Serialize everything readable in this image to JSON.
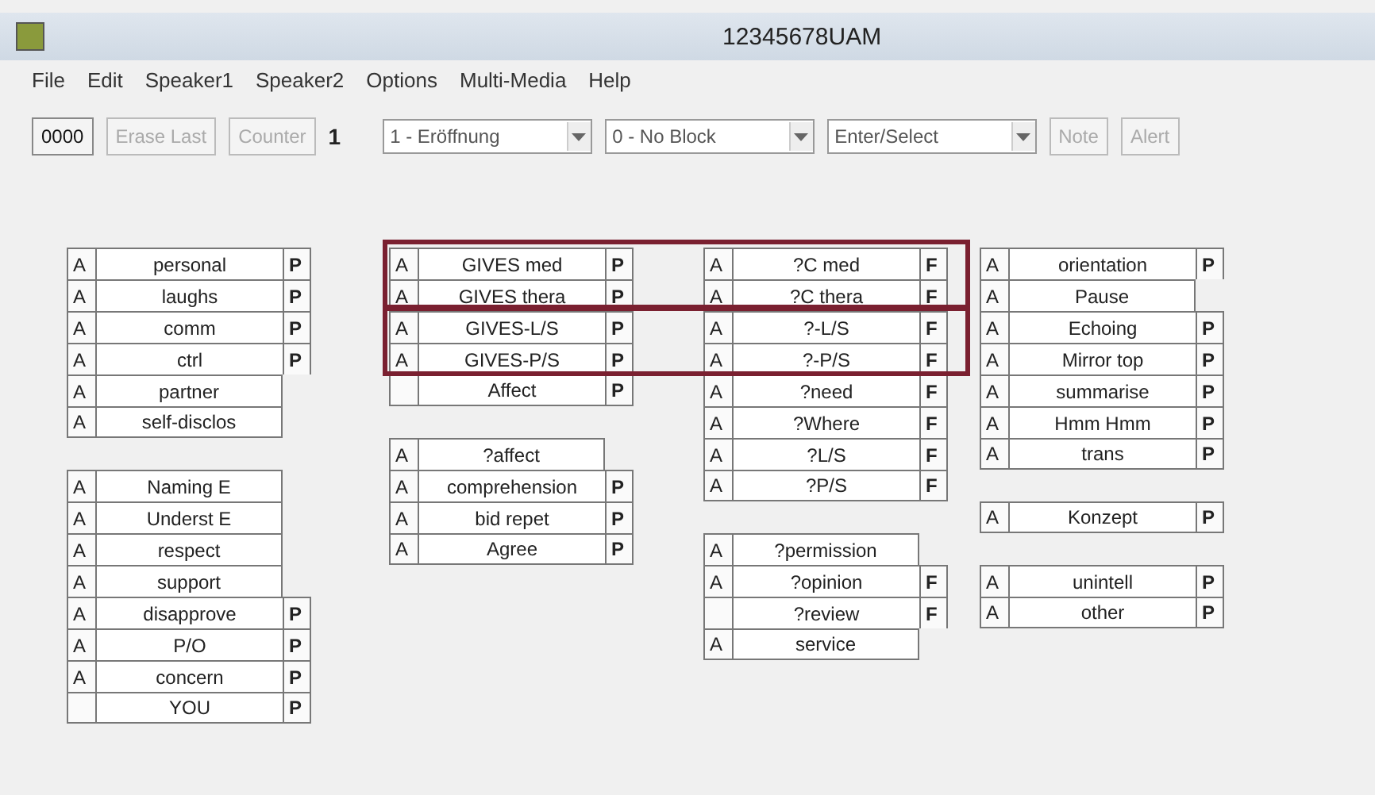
{
  "window": {
    "title": "12345678UAM"
  },
  "menu": [
    "File",
    "Edit",
    "Speaker1",
    "Speaker2",
    "Options",
    "Multi-Media",
    "Help"
  ],
  "toolbar": {
    "code_button": "0000",
    "erase_button": {
      "label": "Erase Last",
      "disabled": true
    },
    "counter_button": {
      "label": "Counter",
      "disabled": true
    },
    "counter_value": "1",
    "dropdowns": [
      {
        "value": "1 - Eröffnung"
      },
      {
        "value": "0 - No Block"
      },
      {
        "value": "Enter/Select"
      }
    ],
    "note_button": {
      "label": "Note",
      "disabled": true
    },
    "alert_button": {
      "label": "Alert",
      "disabled": true
    }
  },
  "columns": [
    {
      "groups": [
        {
          "rows": [
            {
              "a": "A",
              "label": "personal",
              "mark": "P"
            },
            {
              "a": "A",
              "label": "laughs",
              "mark": "P"
            },
            {
              "a": "A",
              "label": "comm",
              "mark": "P"
            },
            {
              "a": "A",
              "label": "ctrl",
              "mark": "P"
            },
            {
              "a": "A",
              "label": "partner"
            },
            {
              "a": "A",
              "label": "self-disclos"
            }
          ]
        },
        {
          "rows": [
            {
              "a": "A",
              "label": "Naming E"
            },
            {
              "a": "A",
              "label": "Underst E"
            },
            {
              "a": "A",
              "label": "respect"
            },
            {
              "a": "A",
              "label": "support"
            },
            {
              "a": "A",
              "label": "disapprove",
              "mark": "P"
            },
            {
              "a": "A",
              "label": "P/O",
              "mark": "P"
            },
            {
              "a": "A",
              "label": "concern",
              "mark": "P"
            },
            {
              "label": "YOU",
              "mark": "P"
            }
          ]
        }
      ]
    },
    {
      "groups": [
        {
          "rows": [
            {
              "a": "A",
              "label": "GIVES med",
              "mark": "P"
            },
            {
              "a": "A",
              "label": "GIVES thera",
              "mark": "P"
            },
            {
              "a": "A",
              "label": "GIVES-L/S",
              "mark": "P"
            },
            {
              "a": "A",
              "label": "GIVES-P/S",
              "mark": "P"
            },
            {
              "label": "Affect",
              "mark": "P"
            }
          ]
        },
        {
          "rows": [
            {
              "a": "A",
              "label": "?affect"
            },
            {
              "a": "A",
              "label": "comprehension",
              "mark": "P"
            },
            {
              "a": "A",
              "label": "bid repet",
              "mark": "P"
            },
            {
              "a": "A",
              "label": "Agree",
              "mark": "P"
            }
          ]
        }
      ]
    },
    {
      "groups": [
        {
          "rows": [
            {
              "a": "A",
              "label": "?C med",
              "mark": "F"
            },
            {
              "a": "A",
              "label": "?C thera",
              "mark": "F"
            },
            {
              "a": "A",
              "label": "?-L/S",
              "mark": "F"
            },
            {
              "a": "A",
              "label": "?-P/S",
              "mark": "F"
            },
            {
              "a": "A",
              "label": "?need",
              "mark": "F"
            },
            {
              "a": "A",
              "label": "?Where",
              "mark": "F"
            },
            {
              "a": "A",
              "label": "?L/S",
              "mark": "F"
            },
            {
              "a": "A",
              "label": "?P/S",
              "mark": "F"
            }
          ]
        },
        {
          "rows": [
            {
              "a": "A",
              "label": "?permission"
            },
            {
              "a": "A",
              "label": "?opinion",
              "mark": "F"
            },
            {
              "label": "?review",
              "mark": "F"
            },
            {
              "a": "A",
              "label": "service"
            }
          ]
        }
      ]
    },
    {
      "groups": [
        {
          "rows": [
            {
              "a": "A",
              "label": "orientation",
              "mark": "P"
            },
            {
              "a": "A",
              "label": "Pause"
            },
            {
              "a": "A",
              "label": "Echoing",
              "mark": "P"
            },
            {
              "a": "A",
              "label": "Mirror top",
              "mark": "P"
            },
            {
              "a": "A",
              "label": "summarise",
              "mark": "P"
            },
            {
              "a": "A",
              "label": "Hmm Hmm",
              "mark": "P"
            },
            {
              "a": "A",
              "label": "trans",
              "mark": "P"
            }
          ]
        },
        {
          "rows": [
            {
              "a": "A",
              "label": "Konzept",
              "mark": "P"
            }
          ]
        },
        {
          "rows": [
            {
              "a": "A",
              "label": "unintell",
              "mark": "P"
            },
            {
              "a": "A",
              "label": "other",
              "mark": "P"
            }
          ]
        }
      ]
    }
  ]
}
